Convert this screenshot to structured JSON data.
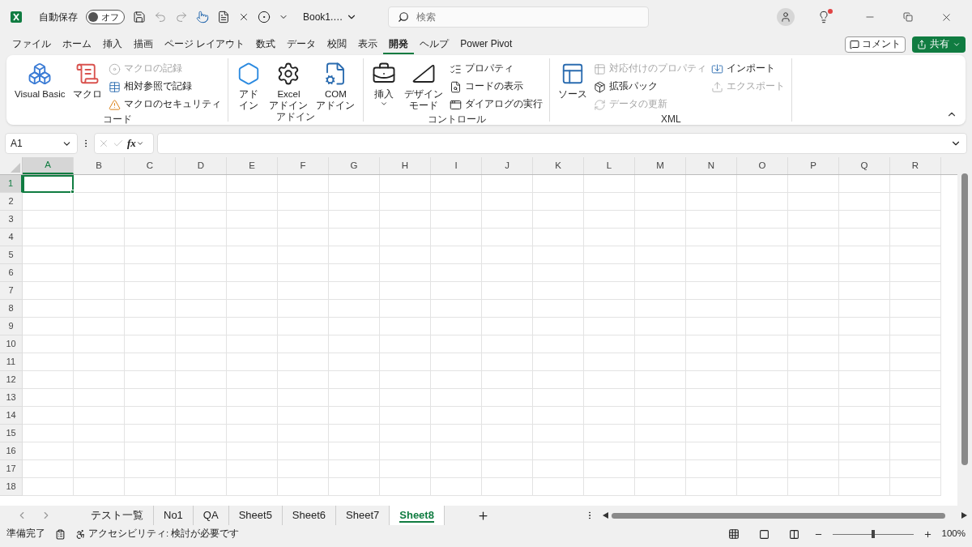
{
  "title_bar": {
    "autosave_label": "自動保存",
    "autosave": {
      "label": "オフ",
      "on": false
    },
    "file_name": "Book1.…",
    "search": {
      "placeholder": "検索"
    },
    "notification": true
  },
  "menu_tabs": [
    {
      "label": "ファイル",
      "selected": false
    },
    {
      "label": "ホーム",
      "selected": false
    },
    {
      "label": "挿入",
      "selected": false
    },
    {
      "label": "描画",
      "selected": false
    },
    {
      "label": "ページ レイアウト",
      "selected": false
    },
    {
      "label": "数式",
      "selected": false
    },
    {
      "label": "データ",
      "selected": false
    },
    {
      "label": "校閲",
      "selected": false
    },
    {
      "label": "表示",
      "selected": false
    },
    {
      "label": "開発",
      "selected": true
    },
    {
      "label": "ヘルプ",
      "selected": false
    },
    {
      "label": "Power Pivot",
      "selected": false
    }
  ],
  "comment_button": "コメント",
  "share_button": "共有",
  "ribbon_groups": [
    {
      "label": "コード",
      "items": [
        {
          "kind": "large",
          "lines": [
            "Visual Basic"
          ],
          "disabled": false
        },
        {
          "kind": "large",
          "lines": [
            "マクロ"
          ],
          "disabled": false
        },
        {
          "kind": "small",
          "label": "マクロの記録",
          "disabled": true
        },
        {
          "kind": "small",
          "label": "相対参照で記録",
          "disabled": false
        },
        {
          "kind": "small",
          "label": "マクロのセキュリティ",
          "disabled": false
        }
      ]
    },
    {
      "label": "アドイン",
      "items": [
        {
          "kind": "large",
          "lines": [
            "アド",
            "イン"
          ],
          "disabled": false
        },
        {
          "kind": "large",
          "lines": [
            "Excel",
            "アドイン"
          ],
          "disabled": false
        },
        {
          "kind": "large",
          "lines": [
            "COM",
            "アドイン"
          ],
          "disabled": false
        }
      ]
    },
    {
      "label": "コントロール",
      "items": [
        {
          "kind": "menu",
          "lines": [
            "挿入"
          ],
          "disabled": false
        },
        {
          "kind": "large",
          "lines": [
            "デザイン",
            "モード"
          ],
          "disabled": false
        },
        {
          "kind": "small",
          "label": "プロパティ",
          "disabled": false
        },
        {
          "kind": "small",
          "label": "コードの表示",
          "disabled": false
        },
        {
          "kind": "small",
          "label": "ダイアログの実行",
          "disabled": false
        }
      ]
    },
    {
      "label": "XML",
      "items": [
        {
          "kind": "large",
          "lines": [
            "ソース"
          ],
          "disabled": false
        },
        {
          "kind": "small",
          "label": "対応付けのプロパティ",
          "disabled": true
        },
        {
          "kind": "small",
          "label": "拡張パック",
          "disabled": false
        },
        {
          "kind": "small",
          "label": "データの更新",
          "disabled": true
        },
        {
          "kind": "small",
          "label": "インポート",
          "disabled": false
        },
        {
          "kind": "small",
          "label": "エクスポート",
          "disabled": true
        }
      ]
    }
  ],
  "formula_bar": {
    "name_box": "A1",
    "function_label": "fx"
  },
  "columns": [
    {
      "label": "A",
      "selected": true
    },
    {
      "label": "B",
      "selected": false
    },
    {
      "label": "C",
      "selected": false
    },
    {
      "label": "D",
      "selected": false
    },
    {
      "label": "E",
      "selected": false
    },
    {
      "label": "F",
      "selected": false
    },
    {
      "label": "G",
      "selected": false
    },
    {
      "label": "H",
      "selected": false
    },
    {
      "label": "I",
      "selected": false
    },
    {
      "label": "J",
      "selected": false
    },
    {
      "label": "K",
      "selected": false
    },
    {
      "label": "L",
      "selected": false
    },
    {
      "label": "M",
      "selected": false
    },
    {
      "label": "N",
      "selected": false
    },
    {
      "label": "O",
      "selected": false
    },
    {
      "label": "P",
      "selected": false
    },
    {
      "label": "Q",
      "selected": false
    },
    {
      "label": "R",
      "selected": false
    }
  ],
  "rows": [
    {
      "label": "1",
      "selected": true
    },
    {
      "label": "2",
      "selected": false
    },
    {
      "label": "3",
      "selected": false
    },
    {
      "label": "4",
      "selected": false
    },
    {
      "label": "5",
      "selected": false
    },
    {
      "label": "6",
      "selected": false
    },
    {
      "label": "7",
      "selected": false
    },
    {
      "label": "8",
      "selected": false
    },
    {
      "label": "9",
      "selected": false
    },
    {
      "label": "10",
      "selected": false
    },
    {
      "label": "11",
      "selected": false
    },
    {
      "label": "12",
      "selected": false
    },
    {
      "label": "13",
      "selected": false
    },
    {
      "label": "14",
      "selected": false
    },
    {
      "label": "15",
      "selected": false
    },
    {
      "label": "16",
      "selected": false
    },
    {
      "label": "17",
      "selected": false
    },
    {
      "label": "18",
      "selected": false
    }
  ],
  "sheet_tabs": [
    {
      "label": "テスト一覧",
      "selected": false
    },
    {
      "label": "No1",
      "selected": false
    },
    {
      "label": "QA",
      "selected": false
    },
    {
      "label": "Sheet5",
      "selected": false
    },
    {
      "label": "Sheet6",
      "selected": false
    },
    {
      "label": "Sheet7",
      "selected": false
    },
    {
      "label": "Sheet8",
      "selected": true
    }
  ],
  "status_bar": {
    "status": "準備完了",
    "accessibility": "アクセシビリティ: 検討が必要です",
    "zoom": {
      "level": 0.5,
      "reading": "100%"
    }
  }
}
